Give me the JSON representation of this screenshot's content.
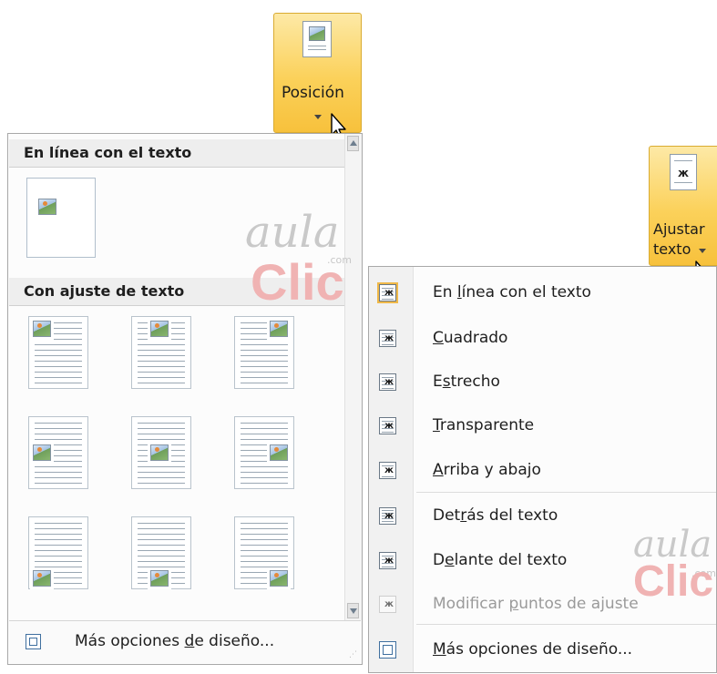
{
  "posicion_button": {
    "label": "Posición"
  },
  "ajustar_button": {
    "label_line1": "Ajustar",
    "label_line2": "texto"
  },
  "position_panel": {
    "inline_header": "En línea con el texto",
    "wrap_header": "Con ajuste de texto",
    "more_options": {
      "prefix": "Más opciones ",
      "mnemonic": "d",
      "suffix": "e diseño..."
    }
  },
  "wrap_menu": {
    "items": [
      {
        "prefix": "En ",
        "mnemonic": "l",
        "suffix": "ínea con el texto",
        "disabled": false,
        "selected": true
      },
      {
        "prefix": "",
        "mnemonic": "C",
        "suffix": "uadrado",
        "disabled": false,
        "selected": false
      },
      {
        "prefix": "E",
        "mnemonic": "s",
        "suffix": "trecho",
        "disabled": false,
        "selected": false
      },
      {
        "prefix": "",
        "mnemonic": "T",
        "suffix": "ransparente",
        "disabled": false,
        "selected": false
      },
      {
        "prefix": "",
        "mnemonic": "A",
        "suffix": "rriba y abajo",
        "disabled": false,
        "selected": false
      },
      {
        "prefix": "Det",
        "mnemonic": "r",
        "suffix": "ás del texto",
        "disabled": false,
        "selected": false
      },
      {
        "prefix": "D",
        "mnemonic": "e",
        "suffix": "lante del texto",
        "disabled": false,
        "selected": false
      },
      {
        "prefix": "Modificar ",
        "mnemonic": "p",
        "suffix": "untos de ajuste",
        "disabled": true,
        "selected": false
      },
      {
        "prefix": "",
        "mnemonic": "M",
        "suffix": "ás opciones de diseño...",
        "disabled": false,
        "selected": false
      }
    ]
  },
  "watermark": {
    "word1": "aula",
    "word2": "Clic",
    "domain": ".com"
  },
  "colors": {
    "ribbon_active": "#fbd15a",
    "selected_outline": "#f0b949"
  }
}
